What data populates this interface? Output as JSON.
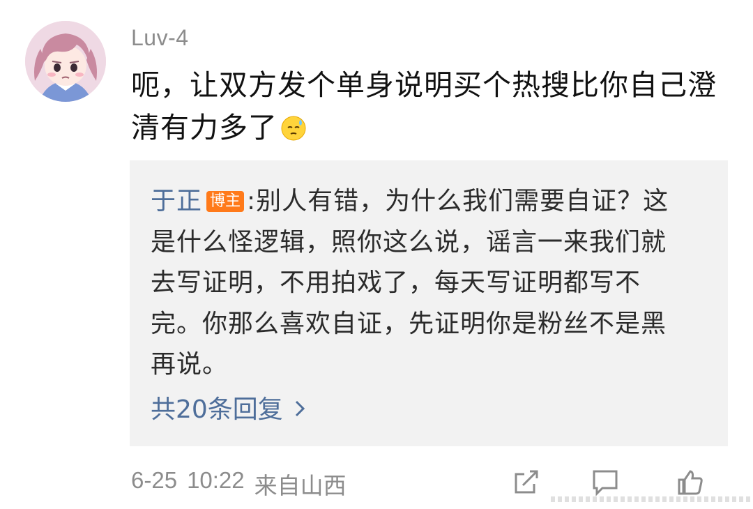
{
  "comment": {
    "username": "Luv-4",
    "text": "呃，让双方发个单身说明买个热搜比你自己澄清有力多了",
    "emoji_name": "sweat-face-emoji"
  },
  "reply": {
    "author": "于正",
    "badge": "博主",
    "separator": ":",
    "text": "别人有错，为什么我们需要自证？这是什么怪逻辑，照你这么说，谣言一来我们就去写证明，不用拍戏了，每天写证明都写不完。你那么喜欢自证，先证明你是粉丝不是黑再说。",
    "more_label": "共20条回复"
  },
  "footer": {
    "date": "6-25",
    "time": "10:22",
    "location": "来自山西",
    "actions": [
      "share-icon",
      "comment-icon",
      "like-icon"
    ]
  },
  "colors": {
    "link": "#4e6e9a",
    "badge": "#ff7a1a",
    "meta": "#8c8c8c",
    "reply_bg": "#f2f2f2"
  }
}
